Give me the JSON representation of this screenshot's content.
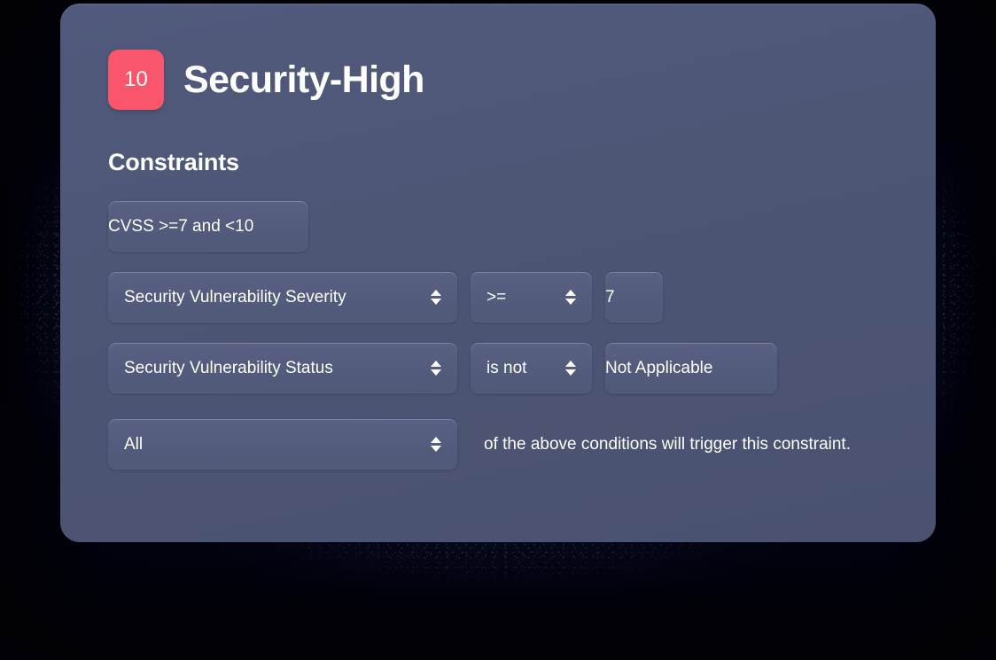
{
  "header": {
    "badge_count": "10",
    "title": "Security-High",
    "badge_color": "#f9556b"
  },
  "section": {
    "heading": "Constraints"
  },
  "cvss_pill": {
    "label": "CVSS >=7 and <10"
  },
  "conditions": [
    {
      "attribute": "Security Vulnerability Severity",
      "operator": ">=",
      "value": "7"
    },
    {
      "attribute": "Security Vulnerability Status",
      "operator": "is not",
      "value": "Not Applicable"
    }
  ],
  "match_rule": {
    "selected": "All",
    "sentence": "of the above conditions will trigger this constraint."
  },
  "icons": {
    "stepper": "stepper-up-down-icon"
  },
  "colors": {
    "card_background": "#4e5677",
    "field_background": "#545c7e",
    "accent_red": "#f9556b",
    "text": "#ffffff",
    "page_background": "#000006"
  }
}
